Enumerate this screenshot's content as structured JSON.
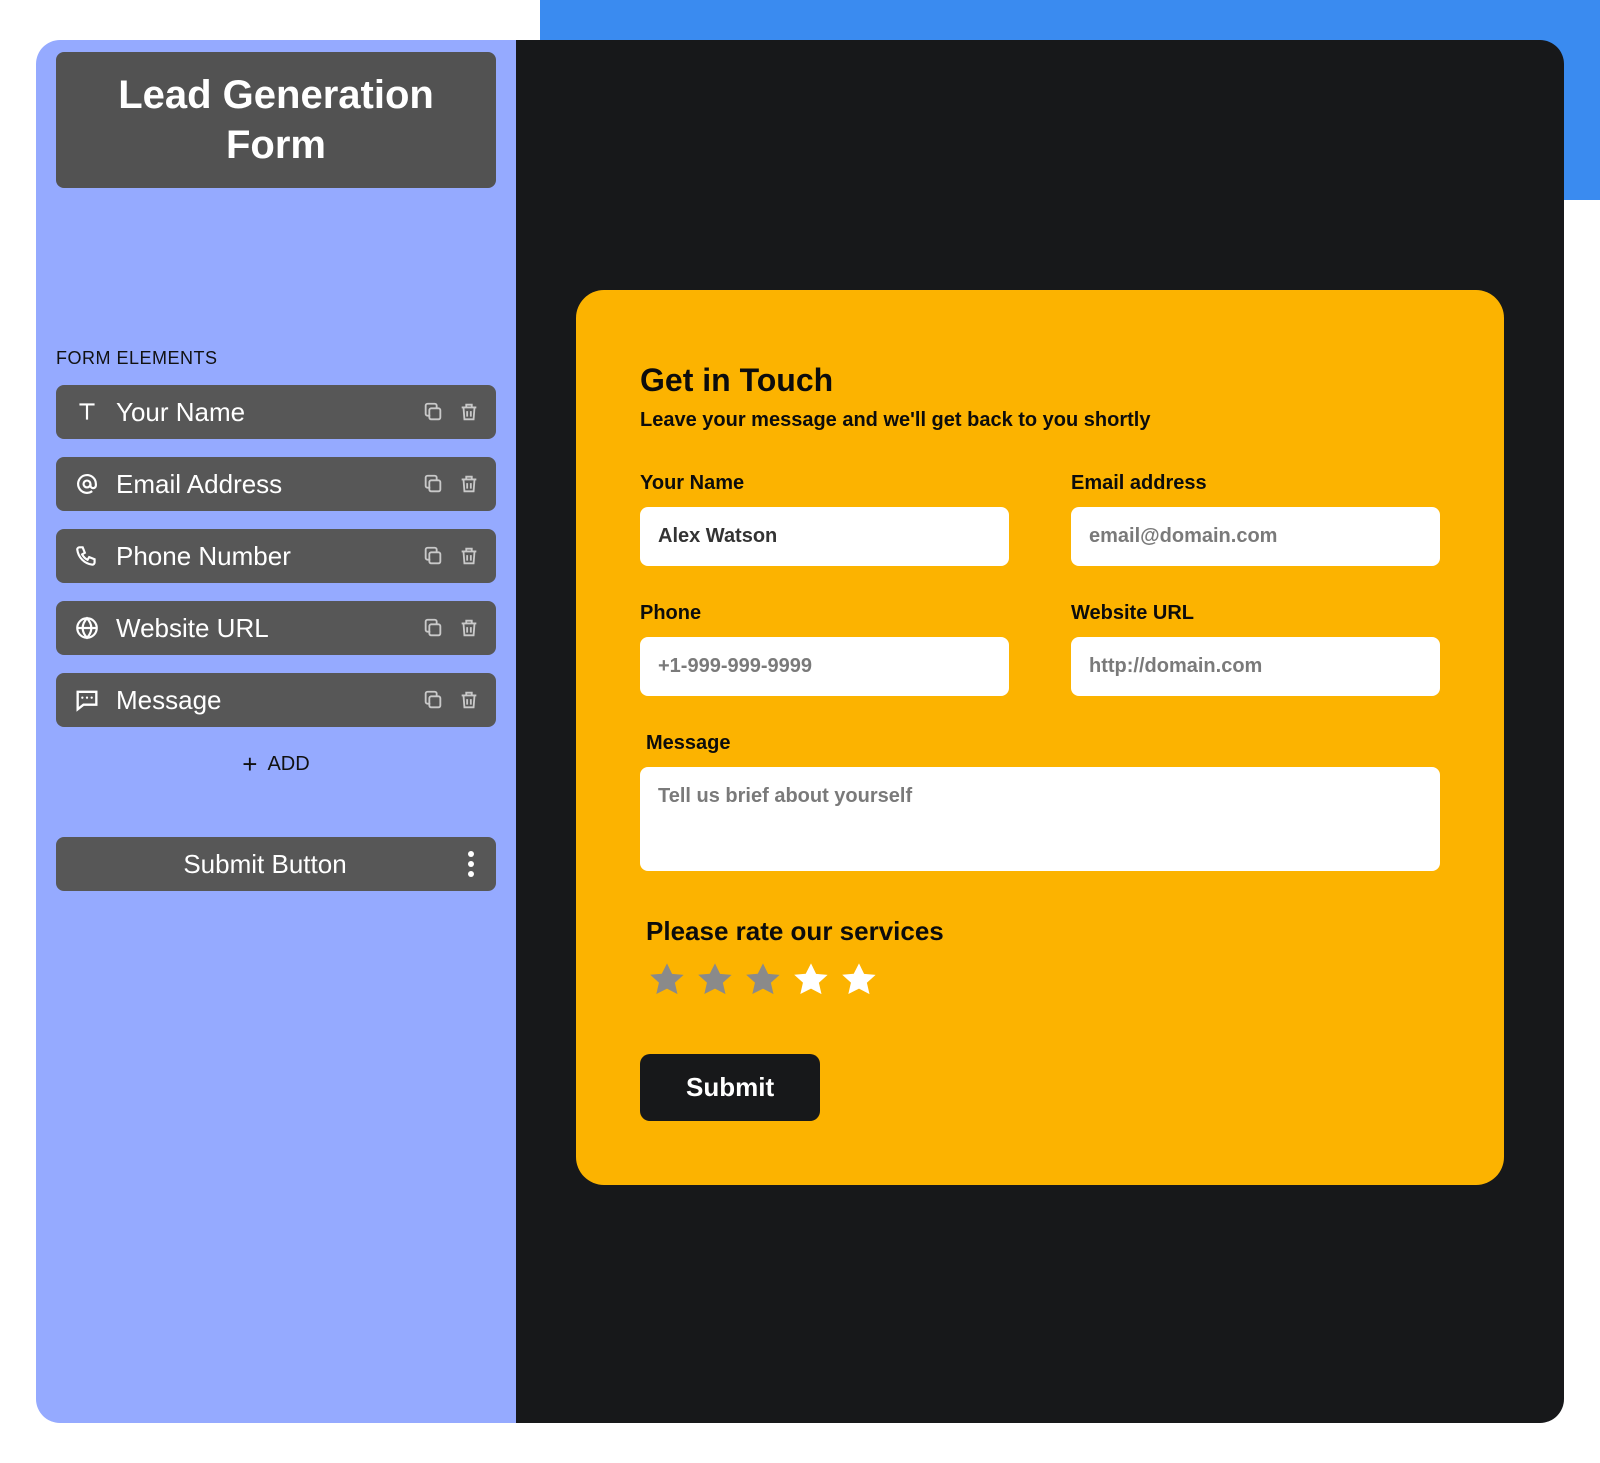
{
  "sidebar": {
    "title": "Lead Generation Form",
    "section_label": "FORM ELEMENTS",
    "elements": [
      {
        "icon": "text-icon",
        "label": "Your Name"
      },
      {
        "icon": "at-icon",
        "label": "Email Address"
      },
      {
        "icon": "phone-icon",
        "label": "Phone Number"
      },
      {
        "icon": "globe-icon",
        "label": "Website URL"
      },
      {
        "icon": "message-icon",
        "label": "Message"
      }
    ],
    "add_label": "ADD",
    "submit_item_label": "Submit Button"
  },
  "form": {
    "title": "Get in Touch",
    "subtitle": "Leave your message and we'll get back to you shortly",
    "fields": {
      "name": {
        "label": "Your Name",
        "value": "Alex Watson",
        "placeholder": ""
      },
      "email": {
        "label": "Email address",
        "value": "",
        "placeholder": "email@domain.com"
      },
      "phone": {
        "label": "Phone",
        "value": "",
        "placeholder": "+1-999-999-9999"
      },
      "website": {
        "label": "Website URL",
        "value": "",
        "placeholder": "http://domain.com"
      },
      "message": {
        "label": "Message",
        "value": "",
        "placeholder": "Tell us brief about yourself"
      }
    },
    "rating": {
      "label": "Please rate our services",
      "value": 3,
      "max": 5,
      "filled_color": "#8a8a8a",
      "empty_color": "#ffffff"
    },
    "submit_label": "Submit"
  },
  "colors": {
    "accent_blue": "#3a8bf0",
    "sidebar_bg": "#95aaff",
    "row_bg": "#575757",
    "preview_bg": "#17181a",
    "form_bg": "#fcb300"
  }
}
